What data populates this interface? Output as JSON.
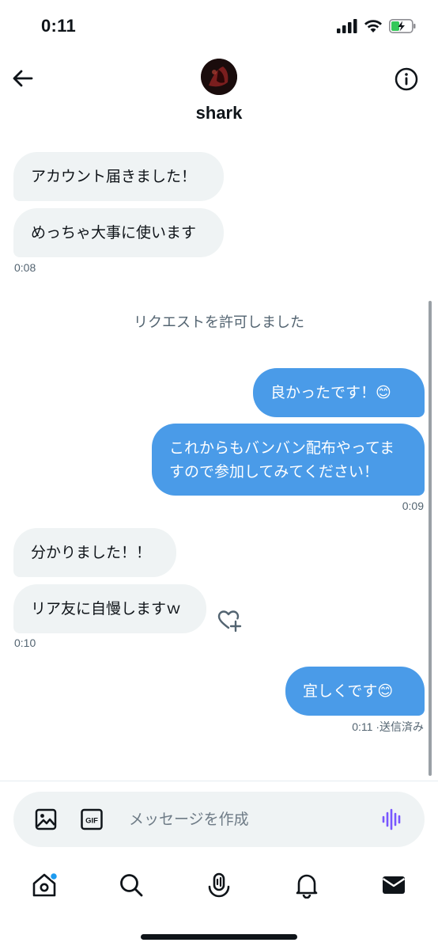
{
  "status_bar": {
    "time": "0:11"
  },
  "header": {
    "name": "shark"
  },
  "messages": {
    "m1": "アカウント届きました！",
    "m2": "めっちゃ大事に使います",
    "t1": "0:08",
    "system": "リクエストを許可しました",
    "m3": "良かったです！😊",
    "m4_line1": "これからもバンバン配布やってま",
    "m4_line2": "すので参加してみてください！",
    "t2": "0:09",
    "m5": "分かりました！！",
    "m6": "リア友に自慢しますｗ",
    "t3": "0:10",
    "m7": "宜しくです😊",
    "t4": "0:11 ·送信済み"
  },
  "composer": {
    "placeholder": "メッセージを作成",
    "gif_label": "GIF"
  },
  "colors": {
    "accent": "#4a9be8",
    "voice": "#7856ff",
    "notification_dot": "#1d9bf0"
  },
  "icons": [
    "back-arrow-icon",
    "info-icon",
    "image-icon",
    "gif-icon",
    "voice-icon",
    "home-icon",
    "search-icon",
    "spaces-icon",
    "bell-icon",
    "mail-icon",
    "heart-add-icon"
  ]
}
